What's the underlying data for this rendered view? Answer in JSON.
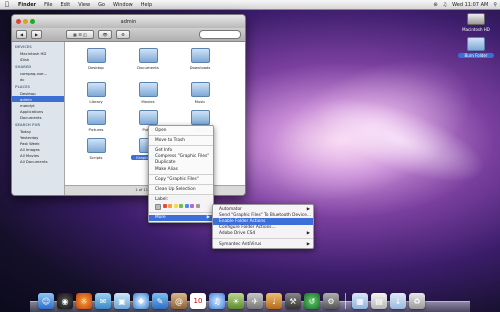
{
  "menubar": {
    "app": "Finder",
    "items": [
      "File",
      "Edit",
      "View",
      "Go",
      "Window",
      "Help"
    ],
    "clock": "Wed 11:07 AM"
  },
  "desktop": {
    "icons": [
      {
        "label": "Macintosh HD",
        "kind": "hd"
      },
      {
        "label": "Burn Folder",
        "kind": "folder"
      }
    ]
  },
  "finder": {
    "title": "admin",
    "sidebar": [
      {
        "heading": "DEVICES",
        "items": [
          "Macintosh HD",
          "iDisk"
        ]
      },
      {
        "heading": "SHARED",
        "items": [
          "compaq-nxe...",
          "dc"
        ]
      },
      {
        "heading": "PLACES",
        "items": [
          "Desktop",
          "admin",
          "mandyt",
          "Applications",
          "Documents"
        ]
      },
      {
        "heading": "SEARCH FOR",
        "items": [
          "Today",
          "Yesterday",
          "Past Week",
          "All Images",
          "All Movies",
          "All Documents"
        ]
      }
    ],
    "selected_sidebar": "admin",
    "folders": [
      "Desktop",
      "Documents",
      "Downloads",
      "Library",
      "Movies",
      "Music",
      "Pictures",
      "Public",
      "Sites",
      "Scripts",
      "Graphic Files"
    ],
    "selected_folder": "Graphic Files",
    "status": "1 of 11 selected, 20..."
  },
  "context_menu": {
    "items": [
      "Open",
      "Move to Trash",
      "Get Info",
      "Compress \"Graphic Files\"",
      "Duplicate",
      "Make Alias",
      "Copy \"Graphic Files\"",
      "Clean Up Selection",
      "Label:",
      "More"
    ],
    "highlighted": "More",
    "label_colors": [
      "#e34b3c",
      "#f2a03a",
      "#f3de40",
      "#6cc04a",
      "#4c8ee8",
      "#b26ad0",
      "#9a9a9a"
    ]
  },
  "submenu": {
    "items": [
      "Automator",
      "Send \"Graphic Files\" To Bluetooth Device...",
      "Enable Folder Actions",
      "Configure Folder Actions...",
      "Adobe Drive CS4",
      "Symantec AntiVirus"
    ],
    "highlighted": "Enable Folder Actions"
  },
  "dock": {
    "icons": [
      "finder-icon",
      "dashboard-icon",
      "firefox-icon",
      "ical-icon",
      "preview-icon",
      "safari-icon",
      "ichat-icon",
      "address-book-icon",
      "calendar-icon",
      "itunes-icon",
      "iphoto-icon",
      "iweb-icon",
      "garageband-icon",
      "instruments-icon",
      "time-machine-icon",
      "system-preferences-icon",
      "folder-icon",
      "documents-icon",
      "downloads-icon",
      "trash-icon"
    ],
    "calendar_day": "10"
  }
}
